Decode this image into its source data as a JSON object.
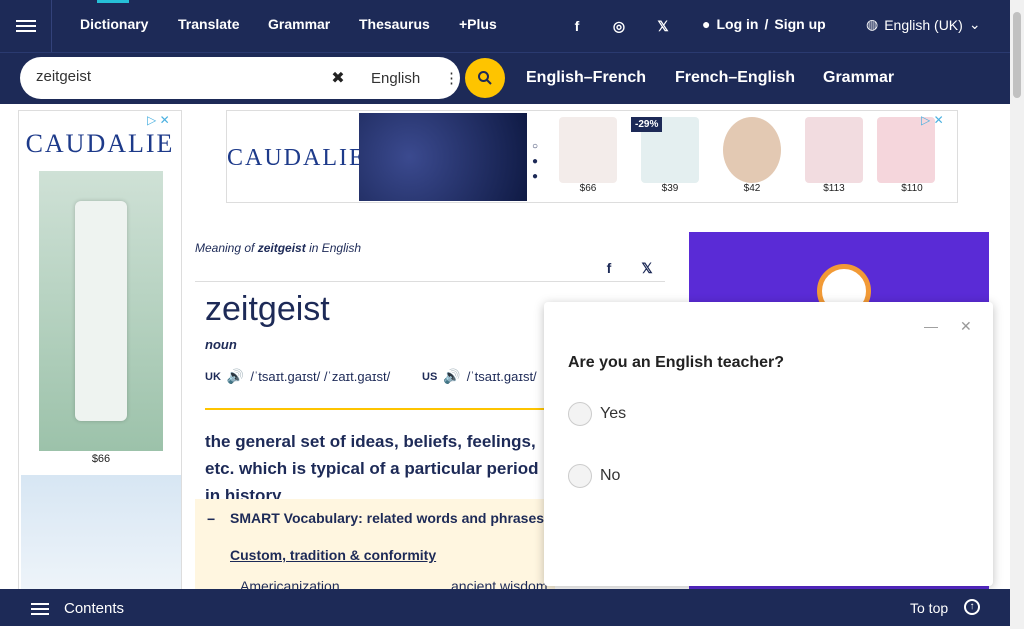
{
  "nav": {
    "links": [
      "Dictionary",
      "Translate",
      "Grammar",
      "Thesaurus",
      "+Plus"
    ],
    "login": "Log in",
    "sep": "/",
    "signup": "Sign up",
    "language": "English (UK)"
  },
  "search": {
    "value": "zeitgeist",
    "dictionary": "English",
    "tabs": [
      "English–French",
      "French–English",
      "Grammar"
    ]
  },
  "ads": {
    "brand": "CAUDALIE",
    "left_price": "$66",
    "discount": "-29%",
    "prices": [
      "$66",
      "$39",
      "$42",
      "$113",
      "$110"
    ]
  },
  "entry": {
    "meaning_prefix": "Meaning of",
    "word": "zeitgeist",
    "meaning_suffix": "in English",
    "headword": "zeitgeist",
    "pos": "noun",
    "uk_label": "UK",
    "uk_ipa": "/ˈtsaɪt.ɡaɪst/ /ˈzaɪt.ɡaɪst/",
    "us_label": "US",
    "us_ipa": "/ˈtsaɪt.ɡaɪst/",
    "definition": "the general set of ideas, beliefs, feelings, etc. which is typical of a particular period in history"
  },
  "smart": {
    "title": "SMART Vocabulary: related words and phrases",
    "link": "Custom, tradition & conformity",
    "items": [
      "Americanization",
      "ancient wisdom"
    ]
  },
  "popup": {
    "question": "Are you an English teacher?",
    "options": [
      "Yes",
      "No"
    ]
  },
  "bottom": {
    "contents": "Contents",
    "to_top": "To top"
  }
}
